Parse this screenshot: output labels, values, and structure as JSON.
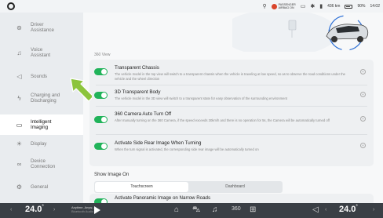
{
  "status_bar": {
    "airbag_line1": "PASSENGER",
    "airbag_line2": "AIRBAG ON",
    "range": "436 km",
    "battery_percent": "90%",
    "time": "14:02"
  },
  "sidebar": {
    "items": [
      {
        "label": "Driver\nAssistance",
        "icon": "steering-icon"
      },
      {
        "label": "Voice\nAssistant",
        "icon": "voice-icon"
      },
      {
        "label": "Sounds",
        "icon": "speaker-icon"
      },
      {
        "label": "Charging and\nDischarging",
        "icon": "charging-icon"
      },
      {
        "label": "Intelligent\nImaging",
        "icon": "camera-icon"
      },
      {
        "label": "Display",
        "icon": "sun-icon"
      },
      {
        "label": "Device\nConnection",
        "icon": "link-icon"
      },
      {
        "label": "General",
        "icon": "gear-icon"
      }
    ],
    "active_index": 4
  },
  "main": {
    "section_title": "360 View",
    "options": [
      {
        "title": "Transparent Chassis",
        "desc": "The vehicle model in the top view will switch to a transparent chassis when the vehicle is traveling at low speed, so as to observe the road conditions under the vehicle and the wheel direction",
        "enabled": true
      },
      {
        "title": "3D Transparent Body",
        "desc": "The vehicle model in the 3D view will switch to a transparent state for easy observation of the surrounding environment",
        "enabled": true
      },
      {
        "title": "360 Camera Auto Turn Off",
        "desc": "After manually turning on the 360 Camera, if the speed exceeds 30km/h and there is no operation for 5s, the Camera will be automatically turned off",
        "enabled": true
      },
      {
        "title": "Activate Side Rear Image When Turning",
        "desc": "When the turn signal is activated, the corresponding side rear image will be automatically turned on",
        "enabled": true
      }
    ],
    "show_image_on_label": "Show Image On",
    "show_image_on_options": [
      "Touchscreen",
      "Dashboard"
    ],
    "show_image_on_selected": "Touchscreen",
    "bottom_option_title": "Activate Panoramic Image on Narrow Roads"
  },
  "bottom_bar": {
    "temp_left": "24.0",
    "temp_right": "24.0",
    "temp_unit": "°",
    "music_title": "Anytime, Anyw...",
    "music_sub": "Bluetooth Audio",
    "camera_label": "360"
  },
  "colors": {
    "toggle_on": "#21b35a",
    "arrow": "#8cc43c"
  }
}
